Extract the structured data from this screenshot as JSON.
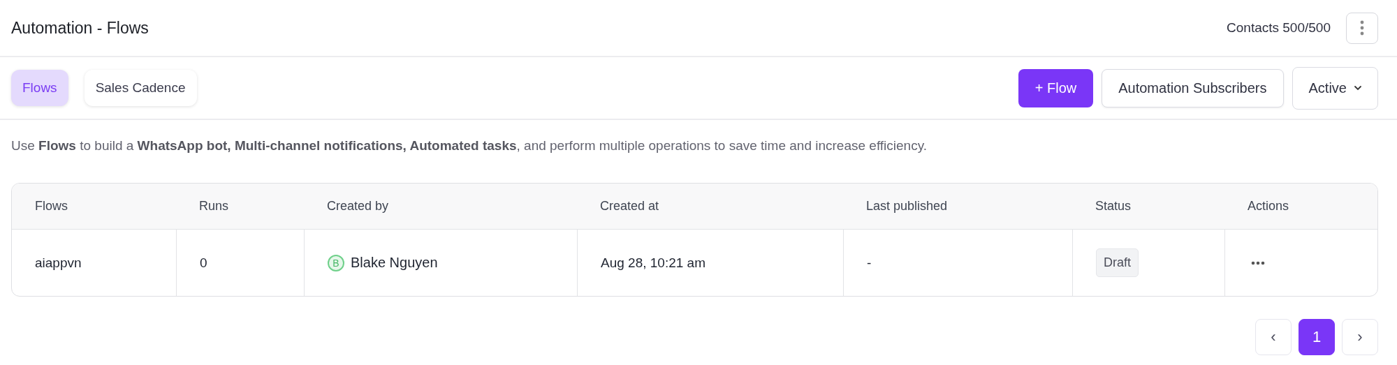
{
  "header": {
    "title": "Automation - Flows",
    "contacts": "Contacts 500/500"
  },
  "tabs": [
    {
      "label": "Flows",
      "selected": true
    },
    {
      "label": "Sales Cadence",
      "selected": false
    }
  ],
  "actions": {
    "new_flow": "+ Flow",
    "subscribers": "Automation Subscribers",
    "filter": "Active"
  },
  "description": "Use **Flows** to build a **WhatsApp bot, Multi-channel notifications, Automated tasks**, and perform multiple operations to save time and increase efficiency.",
  "table": {
    "columns": [
      "Flows",
      "Runs",
      "Created by",
      "Created at",
      "Last published",
      "Status",
      "Actions"
    ],
    "rows": [
      {
        "flow": "aiappvn",
        "runs": "0",
        "creator_initial": "B",
        "creator": "Blake Nguyen",
        "created_at": "Aug 28, 10:21 am",
        "last_published": "-",
        "status": "Draft"
      }
    ]
  },
  "pagination": {
    "prev": "‹",
    "next": "›",
    "pages": [
      {
        "label": "1",
        "selected": true
      }
    ]
  }
}
